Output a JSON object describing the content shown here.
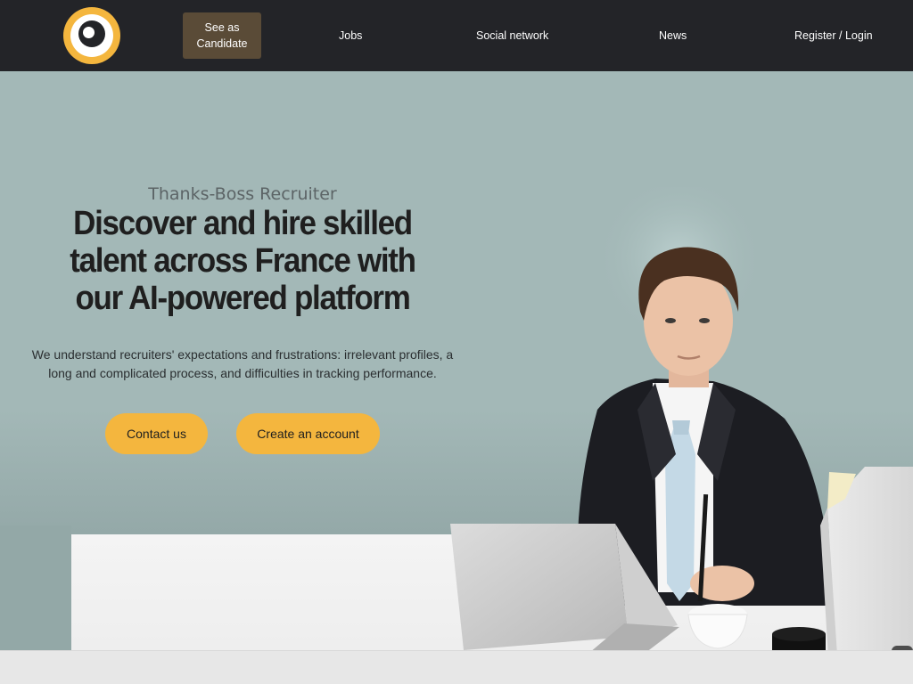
{
  "nav": {
    "logo_icon": "eye-logo-icon",
    "candidate_button": "See as Candidate",
    "links": {
      "jobs": "Jobs",
      "social": "Social network",
      "news": "News",
      "login": "Register / Login"
    }
  },
  "hero": {
    "subtitle": "Thanks-Boss Recruiter",
    "headline": "Discover and hire skilled talent across France with our AI-powered platform",
    "lead": "We understand recruiters' expectations and frustrations: irrelevant profiles, a long and complicated process, and difficulties in tracking performance.",
    "buttons": {
      "contact": "Contact us",
      "create": "Create an account"
    }
  },
  "colors": {
    "nav_bg": "#232428",
    "accent": "#f4b63e",
    "candidate_btn_bg": "#5a4b37",
    "hero_bg": "#a3b8b7"
  }
}
